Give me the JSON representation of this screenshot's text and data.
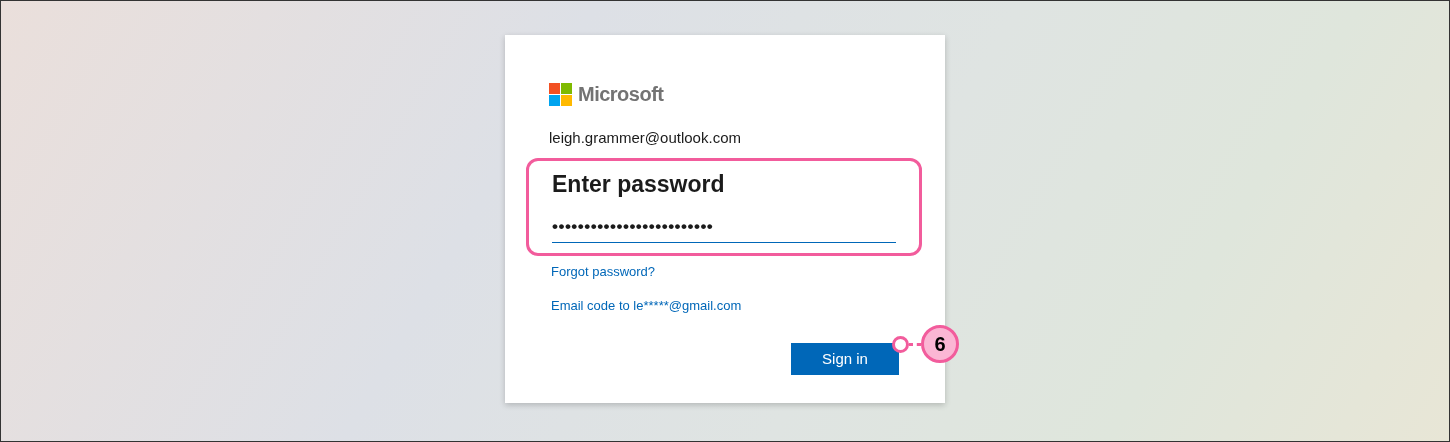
{
  "brand": {
    "name": "Microsoft"
  },
  "account": "leigh.grammer@outlook.com",
  "title": "Enter password",
  "password_field": {
    "value": "•••••••••••••••••••••••••",
    "highlighted": true
  },
  "links": [
    "Forgot password?",
    "Email code to le*****@gmail.com"
  ],
  "button": {
    "label": "Sign in"
  },
  "callout": {
    "number": "6"
  }
}
